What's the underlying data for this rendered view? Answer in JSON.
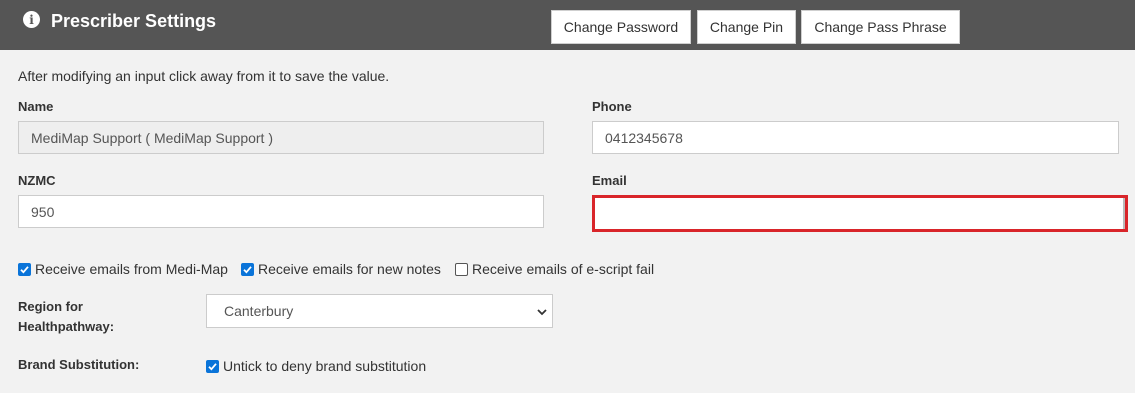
{
  "header": {
    "title": "Prescriber Settings",
    "info_icon": "info-icon",
    "buttons": {
      "change_password": "Change Password",
      "change_pin": "Change Pin",
      "change_pass_phrase": "Change Pass Phrase"
    }
  },
  "note": "After modifying an input click away from it to save the value.",
  "form": {
    "name": {
      "label": "Name",
      "value": "MediMap Support ( MediMap Support )"
    },
    "phone": {
      "label": "Phone",
      "value": "0412345678"
    },
    "nzmc": {
      "label": "NZMC",
      "value": "950"
    },
    "email": {
      "label": "Email",
      "value": "",
      "state": "error",
      "error_color": "#d9252a"
    }
  },
  "checkboxes": {
    "receive_medimap": {
      "label": "Receive emails from Medi-Map",
      "checked": true
    },
    "receive_notes": {
      "label": "Receive emails for new notes",
      "checked": true
    },
    "receive_escript_fail": {
      "label": "Receive emails of e-script fail",
      "checked": false
    }
  },
  "region": {
    "label_line1": "Region for",
    "label_line2": "Healthpathway:",
    "selected": "Canterbury"
  },
  "brand": {
    "label": "Brand Substitution:",
    "checkbox_label": "Untick to deny brand substitution",
    "checked": true
  },
  "colors": {
    "header_bg": "#555555",
    "page_bg": "#f2f2f2",
    "checkbox_accent": "#0a74d9"
  }
}
